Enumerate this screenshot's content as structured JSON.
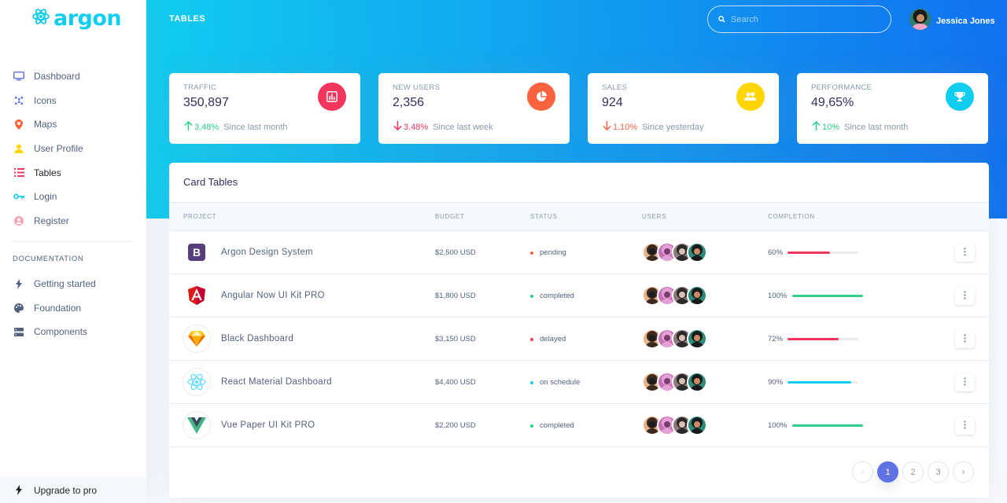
{
  "brand": {
    "name": "argon"
  },
  "sidebar": {
    "items": [
      {
        "label": "Dashboard",
        "icon": "monitor-icon",
        "color": "#5e72e4"
      },
      {
        "label": "Icons",
        "icon": "planet-icon",
        "color": "#5e72e4"
      },
      {
        "label": "Maps",
        "icon": "pin-icon",
        "color": "#fb6340"
      },
      {
        "label": "User Profile",
        "icon": "user-icon",
        "color": "#ffd600"
      },
      {
        "label": "Tables",
        "icon": "bullet-list-icon",
        "color": "#f5365c"
      },
      {
        "label": "Login",
        "icon": "key-icon",
        "color": "#11cdef"
      },
      {
        "label": "Register",
        "icon": "user-circle-icon",
        "color": "#f3a4b5"
      }
    ],
    "doc_heading": "Documentation",
    "doc_items": [
      {
        "label": "Getting started",
        "icon": "spaceship-icon"
      },
      {
        "label": "Foundation",
        "icon": "palette-icon"
      },
      {
        "label": "Components",
        "icon": "ui-components-icon"
      }
    ],
    "upgrade": "Upgrade to pro"
  },
  "header": {
    "title": "TABLES",
    "search_placeholder": "Search",
    "user_name": "Jessica Jones"
  },
  "stats": [
    {
      "title": "Traffic",
      "value": "350,897",
      "change": "3.48%",
      "direction": "up",
      "since": "Since last month",
      "icon": "chart-bar-icon",
      "color": "#f5365c"
    },
    {
      "title": "New users",
      "value": "2,356",
      "change": "3.48%",
      "direction": "down",
      "since": "Since last week",
      "icon": "chart-pie-icon",
      "color": "#fb6340"
    },
    {
      "title": "Sales",
      "value": "924",
      "change": "1.10%",
      "direction": "down",
      "since": "Since yesterday",
      "icon": "users-icon",
      "color": "#ffd600"
    },
    {
      "title": "Performance",
      "value": "49,65%",
      "change": "10%",
      "direction": "up",
      "since": "Since last month",
      "icon": "trophy-icon",
      "color": "#11cdef"
    }
  ],
  "table": {
    "title": "Card Tables",
    "columns": [
      "Project",
      "Budget",
      "Status",
      "Users",
      "Completion"
    ],
    "rows": [
      {
        "project": "Argon Design System",
        "logo": "bootstrap-icon",
        "budget": "$2,500 USD",
        "status": "pending",
        "status_color": "#fb6340",
        "completion": "60%",
        "completion_value": 60,
        "bar_color": "#f5365c"
      },
      {
        "project": "Angular Now UI Kit PRO",
        "logo": "angular-icon",
        "budget": "$1,800 USD",
        "status": "completed",
        "status_color": "#2dce89",
        "completion": "100%",
        "completion_value": 100,
        "bar_color": "#2dce89"
      },
      {
        "project": "Black Dashboard",
        "logo": "sketch-icon",
        "budget": "$3,150 USD",
        "status": "delayed",
        "status_color": "#f5365c",
        "completion": "72%",
        "completion_value": 72,
        "bar_color": "#f5365c"
      },
      {
        "project": "React Material Dashboard",
        "logo": "react-icon",
        "budget": "$4,400 USD",
        "status": "on schedule",
        "status_color": "#11cdef",
        "completion": "90%",
        "completion_value": 90,
        "bar_color": "#11cdef"
      },
      {
        "project": "Vue Paper UI Kit PRO",
        "logo": "vue-icon",
        "budget": "$2,200 USD",
        "status": "completed",
        "status_color": "#2dce89",
        "completion": "100%",
        "completion_value": 100,
        "bar_color": "#2dce89"
      }
    ]
  },
  "pagination": {
    "prev": "‹",
    "pages": [
      "1",
      "2",
      "3"
    ],
    "next": "›",
    "active": "1"
  }
}
